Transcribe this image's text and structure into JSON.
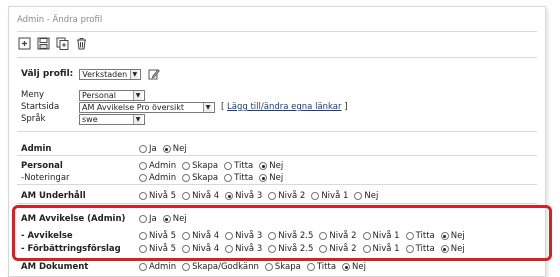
{
  "header": {
    "title": "Admin - Ändra profil"
  },
  "toolbar": {
    "icons": [
      "new-icon",
      "save-icon",
      "copy-icon",
      "delete-icon"
    ]
  },
  "profile": {
    "label": "Välj profil:",
    "selected": "Verkstaden"
  },
  "fields": [
    {
      "label": "Meny",
      "value": "Personal"
    },
    {
      "label": "Startsida",
      "value": "AM Avvikelse Pro översikt"
    },
    {
      "label": "Språk",
      "value": "swe"
    }
  ],
  "startsida_link": {
    "prefix": "[ ",
    "text": "Lägg till/ändra egna länkar",
    "suffix": " ]"
  },
  "permissions": [
    {
      "label": "Admin",
      "main": true,
      "options": [
        "Ja",
        "Nej"
      ],
      "selected": "Nej"
    },
    {
      "label": "Personal",
      "main": true,
      "options": [
        "Admin",
        "Skapa",
        "Titta",
        "Nej"
      ],
      "selected": "Nej"
    },
    {
      "label": "-Noteringar",
      "main": false,
      "options": [
        "Admin",
        "Skapa",
        "Titta",
        "Nej"
      ],
      "selected": "Nej"
    },
    {
      "label": "AM Underhåll",
      "main": true,
      "options": [
        "Nivå 5",
        "Nivå 4",
        "Nivå 3",
        "Nivå 2",
        "Nivå 1",
        "Nej"
      ],
      "selected": "Nivå 3"
    },
    {
      "label": "AM Avvikelse (Admin)",
      "main": true,
      "options": [
        "Ja",
        "Nej"
      ],
      "selected": "Nej"
    },
    {
      "label": "- Avvikelse",
      "main": true,
      "options": [
        "Nivå 5",
        "Nivå 4",
        "Nivå 3",
        "Nivå 2.5",
        "Nivå 2",
        "Nivå 1",
        "Titta",
        "Nej"
      ],
      "selected": "Nej"
    },
    {
      "label": "- Förbättringsförslag",
      "main": true,
      "options": [
        "Nivå 5",
        "Nivå 4",
        "Nivå 3",
        "Nivå 2.5",
        "Nivå 2",
        "Nivå 1",
        "Titta",
        "Nej"
      ],
      "selected": "Nej"
    },
    {
      "label": "AM Dokument",
      "main": true,
      "options": [
        "Admin",
        "Skapa/Godkänn",
        "Skapa",
        "Titta",
        "Nej"
      ],
      "selected": "Nej"
    }
  ],
  "colors": {
    "highlight": "#d92020",
    "link": "#1a3c8c"
  }
}
